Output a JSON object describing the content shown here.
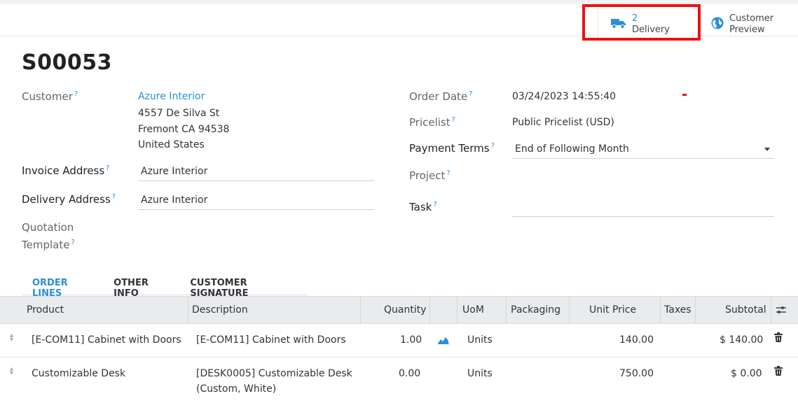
{
  "statbar": {
    "delivery_count": "2",
    "delivery_label": "Delivery",
    "preview_line1": "Customer",
    "preview_line2": "Preview"
  },
  "record": {
    "name": "S00053"
  },
  "customer": {
    "label": "Customer",
    "name": "Azure Interior",
    "street": "4557 De Silva St",
    "city": "Fremont CA 94538",
    "country": "United States"
  },
  "invoice_address": {
    "label": "Invoice Address",
    "value": "Azure Interior"
  },
  "delivery_address": {
    "label": "Delivery Address",
    "value": "Azure Interior"
  },
  "quotation_template": {
    "label_line1": "Quotation",
    "label_line2": "Template"
  },
  "order_date": {
    "label": "Order Date",
    "value": "03/24/2023 14:55:40"
  },
  "pricelist": {
    "label": "Pricelist",
    "value": "Public Pricelist (USD)"
  },
  "payment_terms": {
    "label": "Payment Terms",
    "value": "End of Following Month"
  },
  "project": {
    "label": "Project"
  },
  "task": {
    "label": "Task"
  },
  "tooltip_mark": "?",
  "tabs": [
    {
      "label": "ORDER LINES"
    },
    {
      "label": "OTHER INFO"
    },
    {
      "label": "CUSTOMER SIGNATURE"
    }
  ],
  "columns": {
    "product": "Product",
    "description": "Description",
    "quantity": "Quantity",
    "uom": "UoM",
    "packaging": "Packaging",
    "unit_price": "Unit Price",
    "taxes": "Taxes",
    "subtotal": "Subtotal"
  },
  "lines": [
    {
      "product": "[E-COM11] Cabinet with Doors",
      "description_line1": "[E-COM11] Cabinet with Doors",
      "description_line2": "",
      "quantity": "1.00",
      "uom": "Units",
      "unit_price": "140.00",
      "subtotal": "$ 140.00"
    },
    {
      "product": "Customizable Desk",
      "description_line1": "[DESK0005] Customizable Desk",
      "description_line2": "(Custom, White)",
      "quantity": "0.00",
      "uom": "Units",
      "unit_price": "750.00",
      "subtotal": "$ 0.00"
    }
  ],
  "colors": {
    "accent": "#2a8fd8",
    "highlight": "#ee1111"
  }
}
